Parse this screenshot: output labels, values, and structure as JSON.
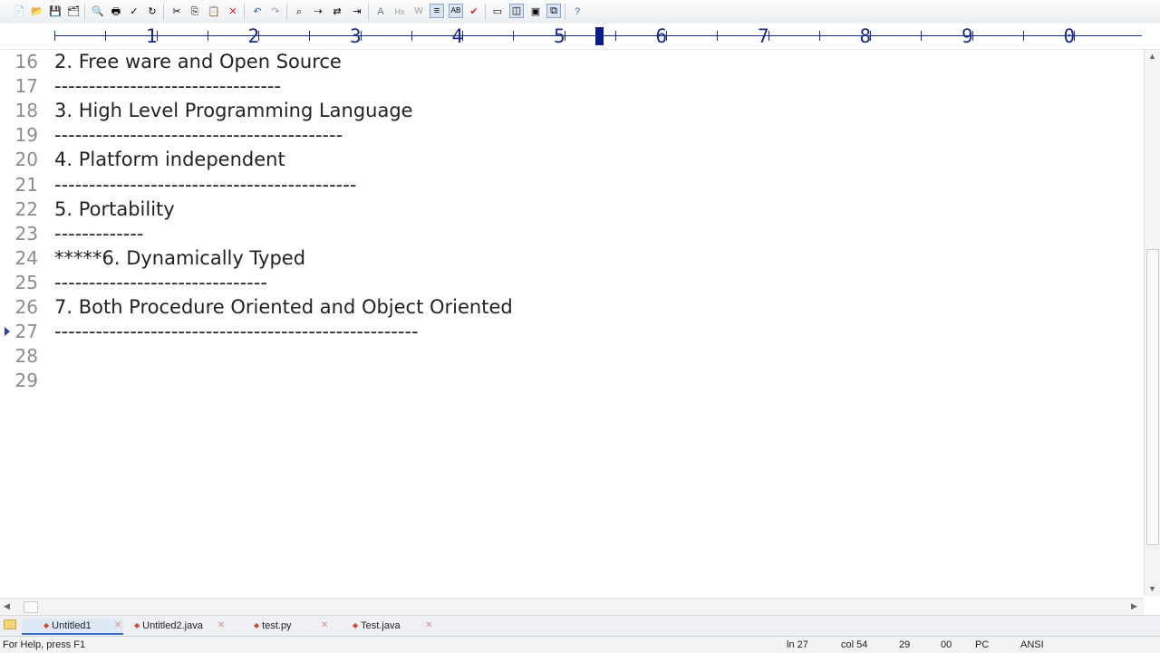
{
  "ruler": {
    "marks": [
      "1",
      "2",
      "3",
      "4",
      "5",
      "6",
      "7",
      "8",
      "9",
      "0"
    ]
  },
  "editor": {
    "lines": [
      {
        "num": "16",
        "text": "2. Free ware and Open Source"
      },
      {
        "num": "17",
        "text": "---------------------------------"
      },
      {
        "num": "18",
        "text": "3. High Level Programming Language"
      },
      {
        "num": "19",
        "text": "------------------------------------------"
      },
      {
        "num": "20",
        "text": "4. Platform independent"
      },
      {
        "num": "21",
        "text": "--------------------------------------------"
      },
      {
        "num": "22",
        "text": "5. Portability"
      },
      {
        "num": "23",
        "text": "-------------"
      },
      {
        "num": "24",
        "text": "*****6. Dynamically Typed"
      },
      {
        "num": "25",
        "text": "-------------------------------"
      },
      {
        "num": "26",
        "text": "7. Both Procedure Oriented and Object Oriented"
      },
      {
        "num": "27",
        "text": "-----------------------------------------------------"
      },
      {
        "num": "28",
        "text": ""
      },
      {
        "num": "29",
        "text": ""
      }
    ]
  },
  "tabs": [
    {
      "label": "Untitled1"
    },
    {
      "label": "Untitled2.java"
    },
    {
      "label": "test.py"
    },
    {
      "label": "Test.java"
    }
  ],
  "status": {
    "help": "For Help, press F1",
    "line": "ln 27",
    "col": "col 54",
    "lines_total": "29",
    "field": "00",
    "format": "PC",
    "encoding": "ANSI"
  },
  "colors": {
    "ruler_text": "#1a2a8c",
    "line_number": "#8c8c8c",
    "text": "#222222"
  }
}
